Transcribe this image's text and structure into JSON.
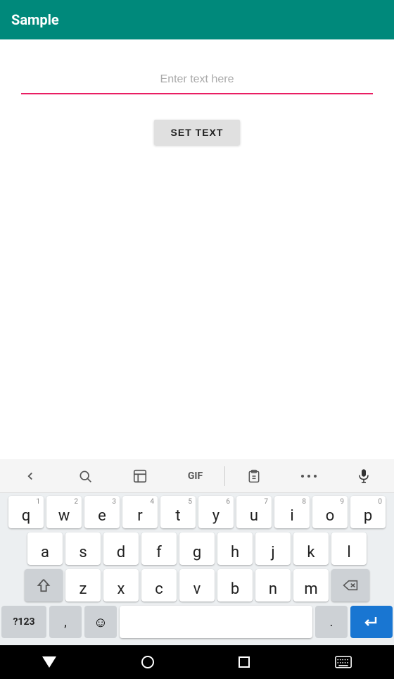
{
  "appBar": {
    "title": "Sample"
  },
  "inputField": {
    "placeholder": "Enter text here",
    "value": ""
  },
  "buttons": {
    "setText": "SET TEXT"
  },
  "keyboard": {
    "toolbar": {
      "back": "‹",
      "search": "🔍",
      "sticker": "🗂",
      "gif": "GIF",
      "clipboard": "📋",
      "more": "•••",
      "mic": "🎤"
    },
    "row1": [
      {
        "letter": "q",
        "num": "1"
      },
      {
        "letter": "w",
        "num": "2"
      },
      {
        "letter": "e",
        "num": "3"
      },
      {
        "letter": "r",
        "num": "4"
      },
      {
        "letter": "t",
        "num": "5"
      },
      {
        "letter": "y",
        "num": "6"
      },
      {
        "letter": "u",
        "num": "7"
      },
      {
        "letter": "i",
        "num": "8"
      },
      {
        "letter": "o",
        "num": "9"
      },
      {
        "letter": "p",
        "num": "0"
      }
    ],
    "row2": [
      {
        "letter": "a"
      },
      {
        "letter": "s"
      },
      {
        "letter": "d"
      },
      {
        "letter": "f"
      },
      {
        "letter": "g"
      },
      {
        "letter": "h"
      },
      {
        "letter": "j"
      },
      {
        "letter": "k"
      },
      {
        "letter": "l"
      }
    ],
    "row3": [
      {
        "letter": "z"
      },
      {
        "letter": "x"
      },
      {
        "letter": "c"
      },
      {
        "letter": "v"
      },
      {
        "letter": "b"
      },
      {
        "letter": "n"
      },
      {
        "letter": "m"
      }
    ],
    "row4": {
      "sym": "?123",
      "comma": ",",
      "emoji": "☺",
      "period": ".",
      "enter": "↵"
    }
  },
  "navBar": {
    "back": "▼",
    "home": "○",
    "recents": "□",
    "keyboard": "⌨"
  }
}
